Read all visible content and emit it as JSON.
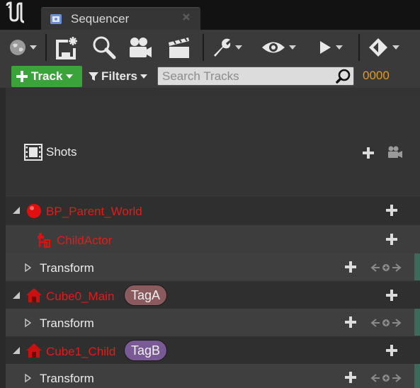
{
  "window": {
    "tab_title": "Sequencer"
  },
  "filter_bar": {
    "track_label": "Track",
    "filters_label": "Filters",
    "search_placeholder": "Search Tracks",
    "frame_number": "0000"
  },
  "shots": {
    "label": "Shots"
  },
  "tracks": [
    {
      "name": "BP_Parent_World",
      "children": [
        "ChildActor"
      ]
    },
    {
      "name": "ChildActor"
    },
    {
      "name": "Transform"
    },
    {
      "name": "Cube0_Main",
      "tag": "TagA"
    },
    {
      "name": "Transform"
    },
    {
      "name": "Cube1_Child",
      "tag": "TagB"
    },
    {
      "name": "Transform"
    }
  ],
  "colors": {
    "track_button_bg": "#3aa33a",
    "actor_label": "#e21b1b",
    "frame_number": "#e09a22",
    "tag_a": "#8a5a5e",
    "tag_b": "#7a5a94"
  },
  "icons": {
    "logo": "unreal-logo-icon",
    "tab": "sequencer-icon",
    "toolbar": [
      "world-icon",
      "save-as-icon",
      "search-icon",
      "camera-icon",
      "clapperboard-icon",
      "wrench-icon",
      "eye-icon",
      "play-icon",
      "keyframe-icon"
    ]
  }
}
